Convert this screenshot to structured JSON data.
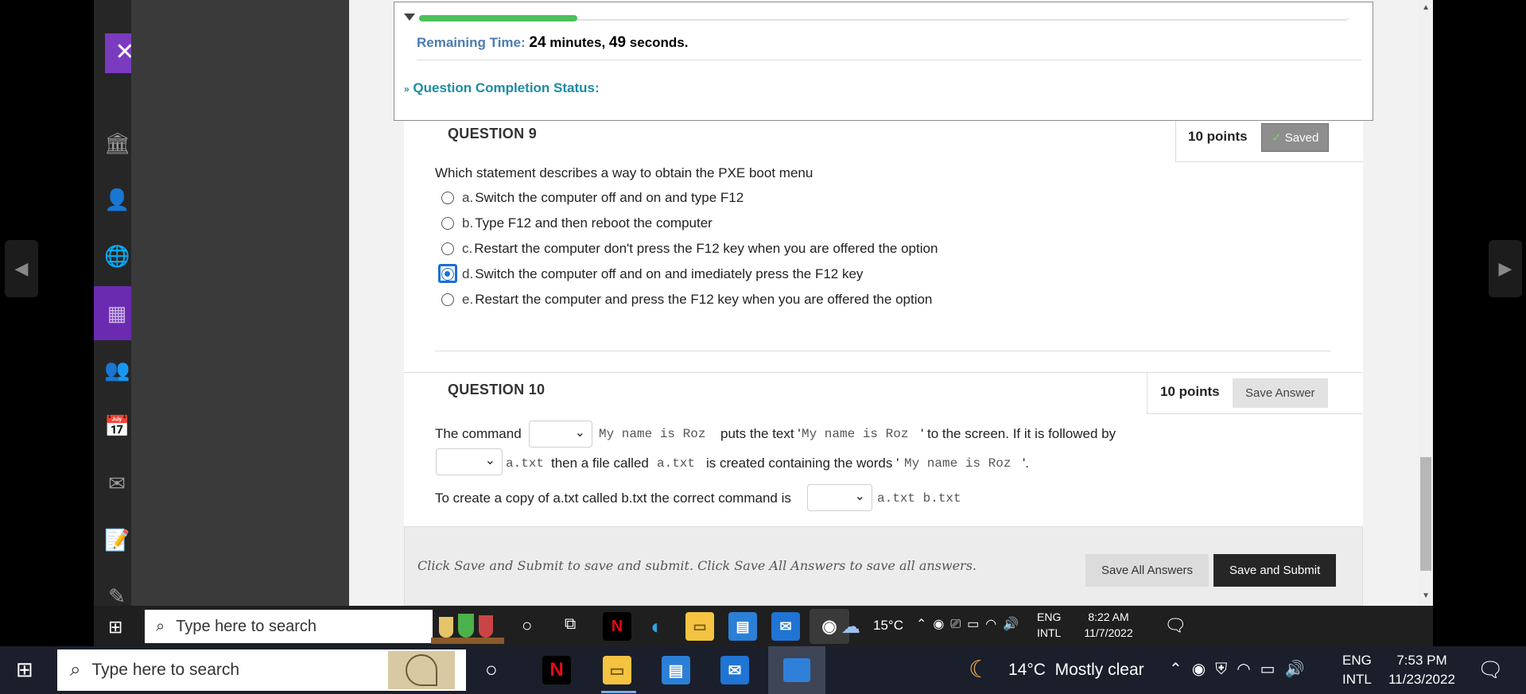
{
  "test": {
    "remaining_label": "Remaining Time:",
    "remaining_minutes": "24",
    "minutes_word": "minutes,",
    "remaining_seconds": "49",
    "seconds_word": "seconds.",
    "progress_fraction": 0.17,
    "completion_status_label": "Question Completion Status:"
  },
  "question9": {
    "title": "QUESTION 9",
    "points": "10 points",
    "status": "Saved",
    "prompt": "Which statement describes a way to obtain the PXE boot menu",
    "options": [
      {
        "letter": "a.",
        "text": "Switch the computer off and on and type F12",
        "checked": false
      },
      {
        "letter": "b.",
        "text": "Type F12 and then reboot the computer",
        "checked": false
      },
      {
        "letter": "c.",
        "text": "Restart the computer don't press the F12 key when you are offered the option",
        "checked": false
      },
      {
        "letter": "d.",
        "text": "Switch the computer off and on and imediately press the F12 key",
        "checked": true
      },
      {
        "letter": "e.",
        "text": "Restart the computer and press the F12 key when you are offered the option",
        "checked": false
      }
    ]
  },
  "question10": {
    "title": "QUESTION 10",
    "points": "10 points",
    "save_answer": "Save Answer",
    "line1_prefix": "The command",
    "line1_code1": "My name is Roz",
    "line1_mid": "puts the text '",
    "line1_code2": "My name is Roz",
    "line1_suffix": "' to the screen. If it is followed by",
    "line2_code1": "a.txt",
    "line2_mid": "then a file called",
    "line2_code2": "a.txt",
    "line2_mid2": "is created containing the words '",
    "line2_code3": "My name is Roz",
    "line2_suffix": "'.",
    "line3_prefix": "To create a copy of a.txt called b.txt the correct command is",
    "line3_code": "a.txt b.txt"
  },
  "submit": {
    "instructions": "Click Save and Submit to save and submit. Click Save All Answers to save all answers.",
    "save_all": "Save All Answers",
    "save_submit": "Save and Submit"
  },
  "inner_taskbar": {
    "search_placeholder": "Type here to search",
    "temperature": "15°C",
    "lang1": "ENG",
    "lang2": "INTL",
    "time": "8:22 AM",
    "date": "11/7/2022"
  },
  "taskbar": {
    "search_placeholder": "Type here to search",
    "weather": "14°C  Mostly clear",
    "lang1": "ENG",
    "lang2": "INTL",
    "time": "7:53 PM",
    "date": "11/23/2022"
  },
  "colors": {
    "accent_purple": "#7a3bbf",
    "progress_green": "#4cc05a",
    "teal": "#1d8ba3",
    "radio_blue": "#1a6ed8"
  }
}
